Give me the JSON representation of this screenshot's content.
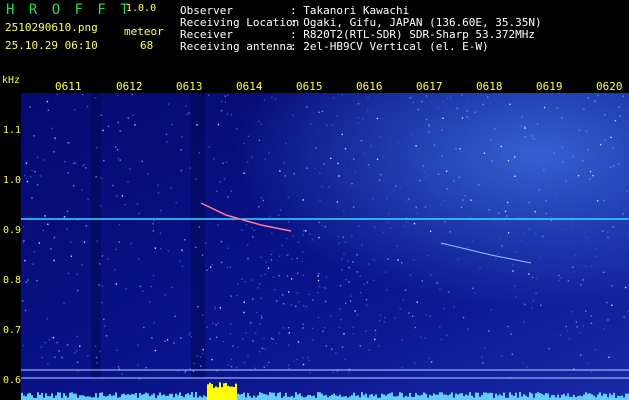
{
  "header": {
    "app_name": "H R O F F T",
    "version": "1.0.0",
    "filename": "2510290610.png",
    "timestamp": "25.10.29 06:10",
    "count_label": "meteor",
    "count_value": "68"
  },
  "info": [
    {
      "label": "Observer",
      "value": ": Takanori Kawachi"
    },
    {
      "label": "Receiving Location",
      "value": ": Ogaki, Gifu, JAPAN (136.60E, 35.35N)"
    },
    {
      "label": "Receiver",
      "value": ": R820T2(RTL-SDR) SDR-Sharp 53.372MHz"
    },
    {
      "label": "Receiving antenna",
      "value": ": 2el-HB9CV Vertical (el. E-W)"
    }
  ],
  "axis": {
    "unit": "kHz",
    "time_ticks": [
      "0611",
      "0612",
      "0613",
      "0614",
      "0615",
      "0616",
      "0617",
      "0618",
      "0619",
      "0620"
    ],
    "freq_ticks": [
      "1.1",
      "1.0",
      "0.9",
      "0.8",
      "0.7",
      "0.6"
    ]
  },
  "colors": {
    "background": "#000000",
    "spectrogram_bg": "#0a0f8c",
    "carrier_line": "#33ddff",
    "meteor_head": "#ff6699",
    "tick_text": "#ffff44",
    "title_text": "#22dd55",
    "power_bar": "#ffff00"
  }
}
